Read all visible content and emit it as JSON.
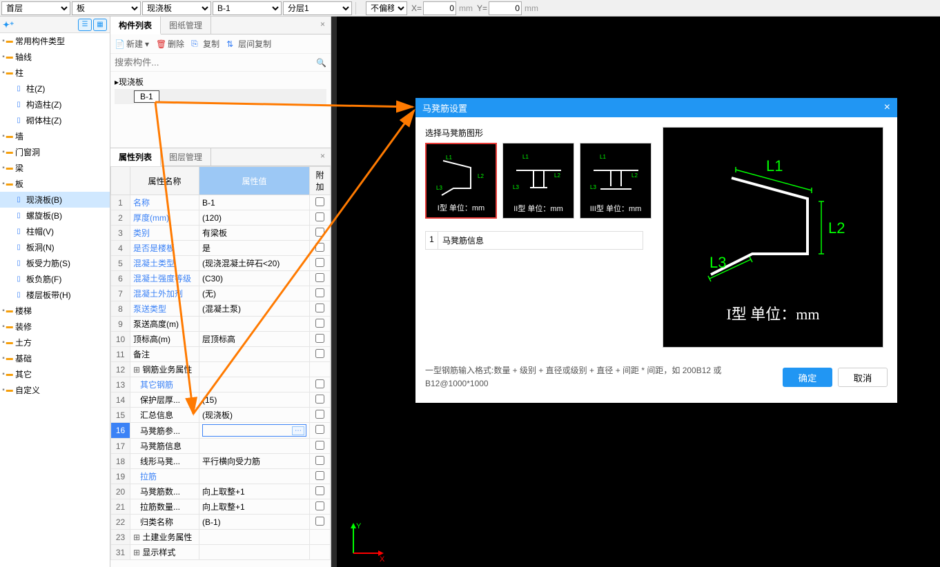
{
  "topbar": {
    "sel_floor": "首层",
    "sel_cat": "板",
    "sel_type": "现浇板",
    "sel_name": "B-1",
    "sel_layer": "分层1",
    "sel_offset": "不偏移",
    "x_label": "X=",
    "x_val": "0",
    "y_label": "Y=",
    "y_val": "0",
    "mm": "mm"
  },
  "left_tree": [
    {
      "l": 1,
      "icon": "folder",
      "label": "常用构件类型"
    },
    {
      "l": 1,
      "icon": "folder",
      "label": "轴线"
    },
    {
      "l": 1,
      "icon": "folder",
      "label": "柱"
    },
    {
      "l": 2,
      "icon": "item",
      "label": "柱(Z)"
    },
    {
      "l": 2,
      "icon": "item",
      "label": "构造柱(Z)"
    },
    {
      "l": 2,
      "icon": "item",
      "label": "砌体柱(Z)"
    },
    {
      "l": 1,
      "icon": "folder",
      "label": "墙"
    },
    {
      "l": 1,
      "icon": "folder",
      "label": "门窗洞"
    },
    {
      "l": 1,
      "icon": "folder",
      "label": "梁"
    },
    {
      "l": 1,
      "icon": "folder",
      "label": "板"
    },
    {
      "l": 2,
      "icon": "item",
      "label": "现浇板(B)",
      "sel": true
    },
    {
      "l": 2,
      "icon": "item",
      "label": "螺旋板(B)"
    },
    {
      "l": 2,
      "icon": "item",
      "label": "柱帽(V)"
    },
    {
      "l": 2,
      "icon": "item",
      "label": "板洞(N)"
    },
    {
      "l": 2,
      "icon": "item",
      "label": "板受力筋(S)"
    },
    {
      "l": 2,
      "icon": "item",
      "label": "板负筋(F)"
    },
    {
      "l": 2,
      "icon": "item",
      "label": "楼层板带(H)"
    },
    {
      "l": 1,
      "icon": "folder",
      "label": "楼梯"
    },
    {
      "l": 1,
      "icon": "folder",
      "label": "装修"
    },
    {
      "l": 1,
      "icon": "folder",
      "label": "土方"
    },
    {
      "l": 1,
      "icon": "folder",
      "label": "基础"
    },
    {
      "l": 1,
      "icon": "folder",
      "label": "其它"
    },
    {
      "l": 1,
      "icon": "folder",
      "label": "自定义"
    }
  ],
  "comp_panel": {
    "tabs": [
      "构件列表",
      "图纸管理"
    ],
    "toolbar": {
      "new": "新建",
      "del": "删除",
      "copy": "复制",
      "lcopy": "层间复制"
    },
    "search_ph": "搜索构件...",
    "root": "现浇板",
    "child": "B-1"
  },
  "prop_panel": {
    "tabs": [
      "属性列表",
      "图层管理"
    ],
    "headers": {
      "name": "属性名称",
      "value": "属性值",
      "extra": "附加"
    },
    "rows": [
      {
        "n": 1,
        "name": "名称",
        "val": "B-1",
        "chk": false,
        "link": true
      },
      {
        "n": 2,
        "name": "厚度(mm)",
        "val": "(120)",
        "chk": true,
        "link": true
      },
      {
        "n": 3,
        "name": "类别",
        "val": "有梁板",
        "chk": true,
        "link": true
      },
      {
        "n": 4,
        "name": "是否是楼板",
        "val": "是",
        "chk": true,
        "link": true
      },
      {
        "n": 5,
        "name": "混凝土类型",
        "val": "(现浇混凝土碎石<20)",
        "chk": true,
        "link": true
      },
      {
        "n": 6,
        "name": "混凝土强度等级",
        "val": "(C30)",
        "chk": true,
        "link": true
      },
      {
        "n": 7,
        "name": "混凝土外加剂",
        "val": "(无)",
        "chk": false,
        "link": true
      },
      {
        "n": 8,
        "name": "泵送类型",
        "val": "(混凝土泵)",
        "chk": false,
        "link": true
      },
      {
        "n": 9,
        "name": "泵送高度(m)",
        "val": "",
        "chk": false
      },
      {
        "n": 10,
        "name": "顶标高(m)",
        "val": "层顶标高",
        "chk": true
      },
      {
        "n": 11,
        "name": "备注",
        "val": "",
        "chk": true
      },
      {
        "n": 12,
        "name": "钢筋业务属性",
        "val": "",
        "group": true
      },
      {
        "n": 13,
        "name": "其它钢筋",
        "val": "",
        "chk": false,
        "link": true,
        "indent": true
      },
      {
        "n": 14,
        "name": "保护层厚...",
        "val": "(15)",
        "chk": true,
        "indent": true
      },
      {
        "n": 15,
        "name": "汇总信息",
        "val": "(现浇板)",
        "chk": true,
        "indent": true
      },
      {
        "n": 16,
        "name": "马凳筋参...",
        "val": "",
        "chk": true,
        "sel": true,
        "indent": true,
        "edit": true
      },
      {
        "n": 17,
        "name": "马凳筋信息",
        "val": "",
        "chk": true,
        "indent": true
      },
      {
        "n": 18,
        "name": "线形马凳...",
        "val": "平行横向受力筋",
        "chk": true,
        "indent": true
      },
      {
        "n": 19,
        "name": "拉筋",
        "val": "",
        "chk": true,
        "link": true,
        "indent": true
      },
      {
        "n": 20,
        "name": "马凳筋数...",
        "val": "向上取整+1",
        "chk": true,
        "indent": true
      },
      {
        "n": 21,
        "name": "拉筋数量...",
        "val": "向上取整+1",
        "chk": true,
        "indent": true
      },
      {
        "n": 22,
        "name": "归类名称",
        "val": "(B-1)",
        "chk": true,
        "indent": true
      },
      {
        "n": 23,
        "name": "土建业务属性",
        "val": "",
        "group": true
      },
      {
        "n": 31,
        "name": "显示样式",
        "val": "",
        "group": true
      }
    ]
  },
  "dialog": {
    "title": "马凳筋设置",
    "group_label": "选择马凳筋图形",
    "shapes": [
      {
        "cap": "I型 单位：mm",
        "sel": true
      },
      {
        "cap": "II型 单位：mm"
      },
      {
        "cap": "III型 单位：mm"
      }
    ],
    "info_n": "1",
    "info_label": "马凳筋信息",
    "preview_cap": "I型 单位：mm",
    "hint": "一型钢筋输入格式:数量 + 级别 + 直径或级别 + 直径 + 间距 * 间距，如 200B12 或 B12@1000*1000",
    "ok": "确定",
    "cancel": "取消",
    "L1": "L1",
    "L2": "L2",
    "L3": "L3"
  }
}
